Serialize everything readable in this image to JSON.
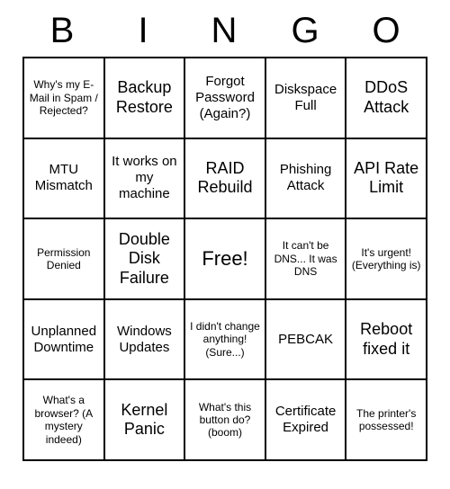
{
  "header": [
    "B",
    "I",
    "N",
    "G",
    "O"
  ],
  "grid": [
    [
      {
        "text": "Why's my E-Mail in Spam / Rejected?",
        "size": "small"
      },
      {
        "text": "Backup Restore",
        "size": "large"
      },
      {
        "text": "Forgot Password (Again?)",
        "size": "med"
      },
      {
        "text": "Diskspace Full",
        "size": "med"
      },
      {
        "text": "DDoS Attack",
        "size": "large"
      }
    ],
    [
      {
        "text": "MTU Mismatch",
        "size": "med"
      },
      {
        "text": "It works on my machine",
        "size": "med"
      },
      {
        "text": "RAID Rebuild",
        "size": "large"
      },
      {
        "text": "Phishing Attack",
        "size": "med"
      },
      {
        "text": "API Rate Limit",
        "size": "large"
      }
    ],
    [
      {
        "text": "Permission Denied",
        "size": "small"
      },
      {
        "text": "Double Disk Failure",
        "size": "large"
      },
      {
        "text": "Free!",
        "size": "free"
      },
      {
        "text": "It can't be DNS... It was DNS",
        "size": "small"
      },
      {
        "text": "It's urgent! (Everything is)",
        "size": "small"
      }
    ],
    [
      {
        "text": "Unplanned Downtime",
        "size": "med"
      },
      {
        "text": "Windows Updates",
        "size": "med"
      },
      {
        "text": "I didn't change anything! (Sure...)",
        "size": "small"
      },
      {
        "text": "PEBCAK",
        "size": "med"
      },
      {
        "text": "Reboot fixed it",
        "size": "large"
      }
    ],
    [
      {
        "text": "What's a browser? (A mystery indeed)",
        "size": "small"
      },
      {
        "text": "Kernel Panic",
        "size": "large"
      },
      {
        "text": "What's this button do? (boom)",
        "size": "small"
      },
      {
        "text": "Certificate Expired",
        "size": "med"
      },
      {
        "text": "The printer's possessed!",
        "size": "small"
      }
    ]
  ]
}
